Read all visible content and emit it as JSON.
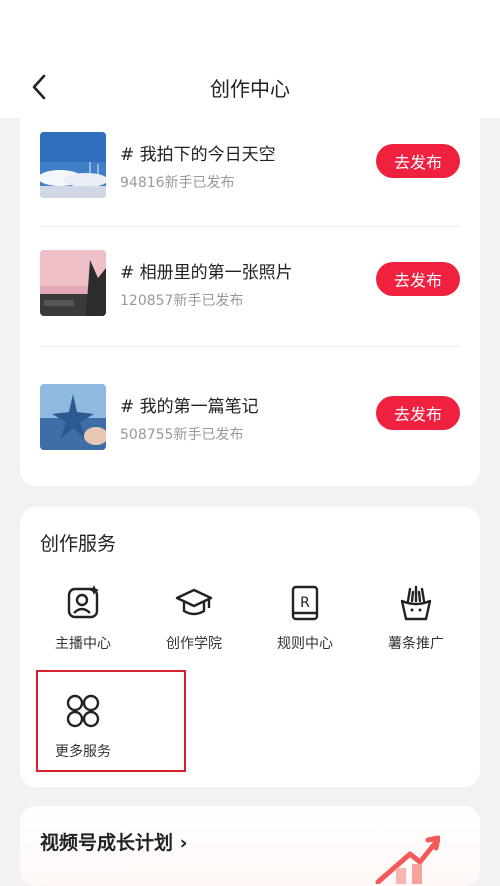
{
  "header": {
    "title": "创作中心",
    "back_icon": "chevron-left-icon"
  },
  "tasks": [
    {
      "title": "# 我拍下的今日天空",
      "subtitle": "94816新手已发布",
      "button": "去发布",
      "thumb": "sky-photo"
    },
    {
      "title": "# 相册里的第一张照片",
      "subtitle": "120857新手已发布",
      "button": "去发布",
      "thumb": "pink-sky-photo"
    },
    {
      "title": "# 我的第一篇笔记",
      "subtitle": "508755新手已发布",
      "button": "去发布",
      "thumb": "starfish-photo"
    }
  ],
  "services": {
    "title": "创作服务",
    "items": [
      {
        "label": "主播中心",
        "icon": "anchor-profile-icon"
      },
      {
        "label": "创作学院",
        "icon": "graduation-cap-icon"
      },
      {
        "label": "规则中心",
        "icon": "rules-book-icon"
      },
      {
        "label": "薯条推广",
        "icon": "fries-promo-icon"
      },
      {
        "label": "更多服务",
        "icon": "more-grid-icon"
      }
    ]
  },
  "growth": {
    "title": "视频号成长计划 ›"
  },
  "colors": {
    "accent": "#f0203f",
    "highlight": "#d5202e"
  }
}
